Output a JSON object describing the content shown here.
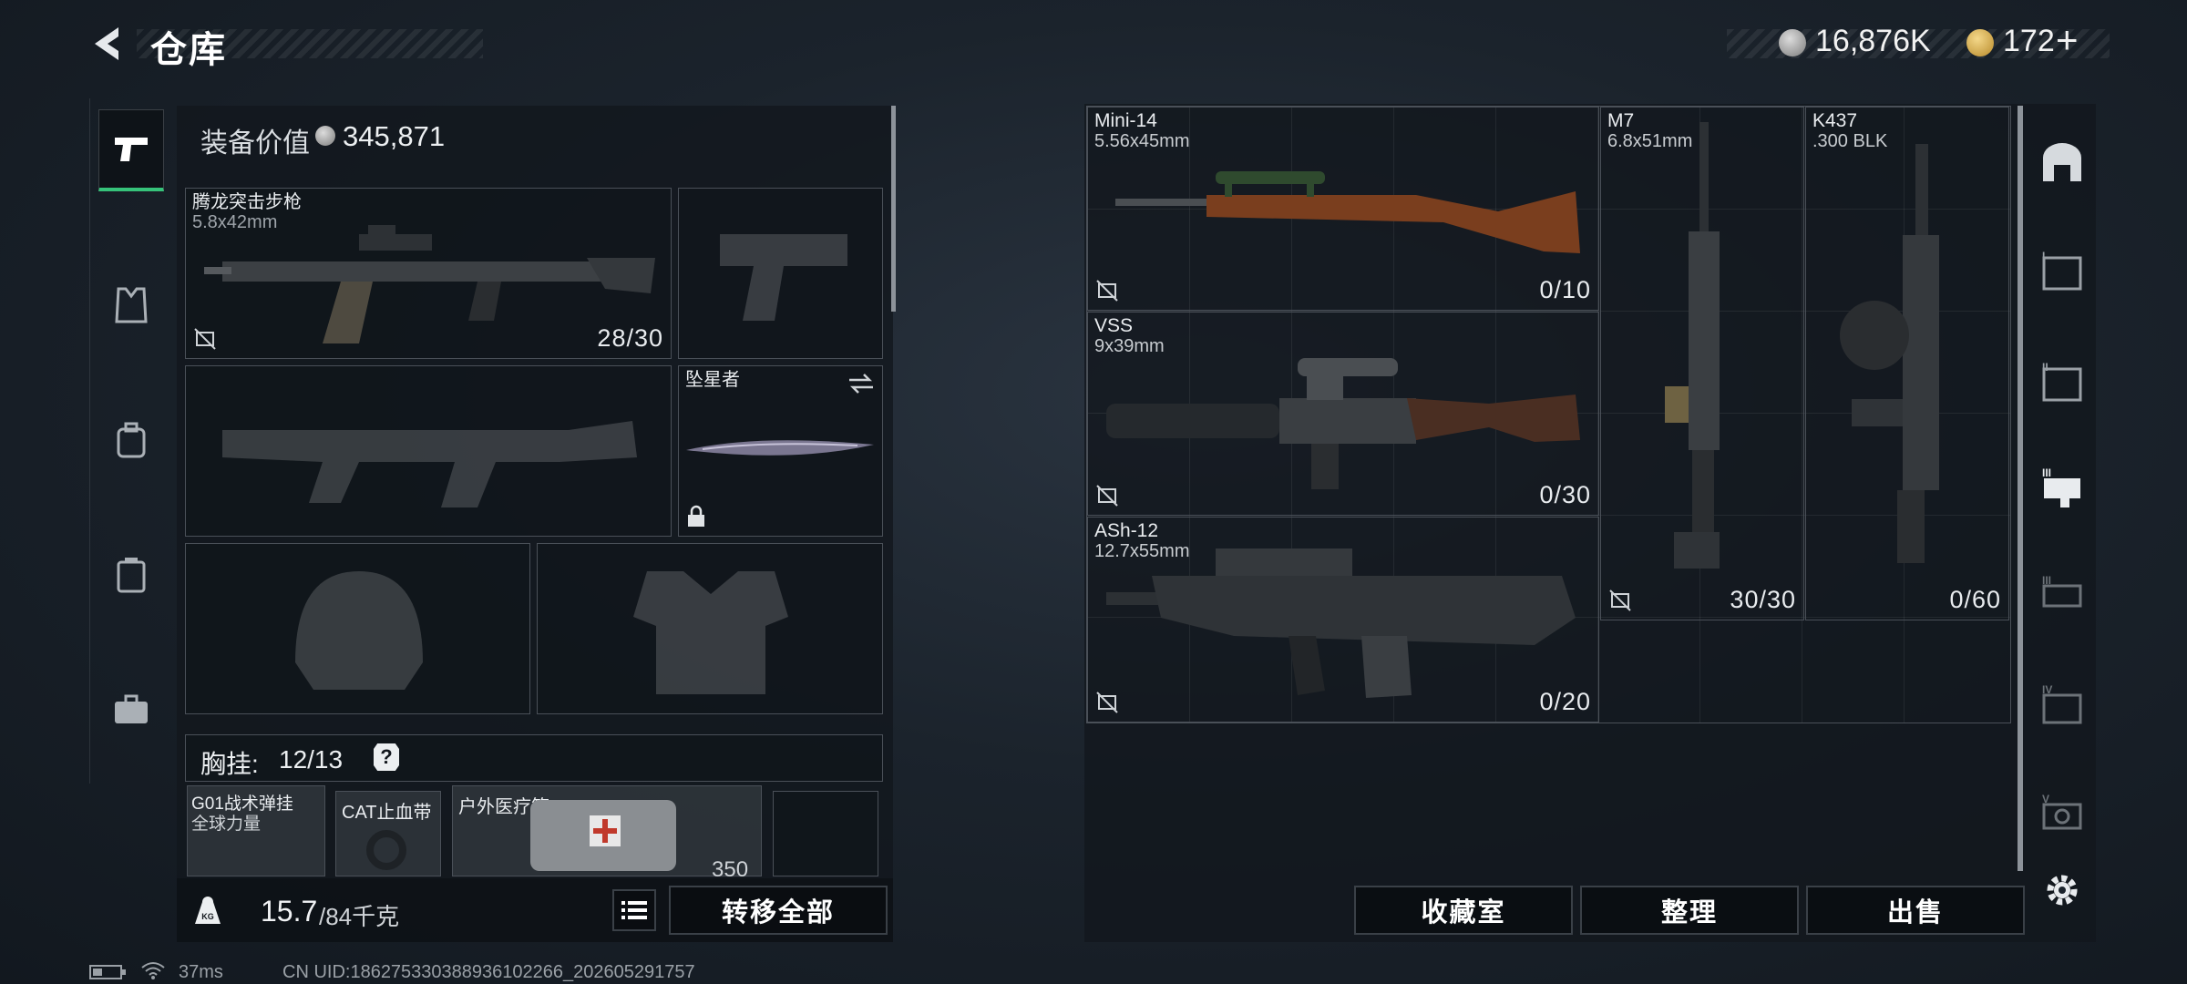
{
  "header": {
    "title": "仓库",
    "currency1_value": "16,876K",
    "currency2_value": "172",
    "currency2_plus": "+"
  },
  "equipment": {
    "value_label": "装备价值",
    "value": "345,871",
    "primary_weapon": {
      "name": "腾龙突击步枪",
      "caliber": "5.8x42mm",
      "ammo": "28/30"
    },
    "melee": {
      "name": "坠星者"
    },
    "chest_rig_label": "胸挂:",
    "chest_rig_capacity": "12/13",
    "help_symbol": "?",
    "items": [
      {
        "line1": "G01战术弹挂",
        "line2": "全球力量"
      },
      {
        "line1": "CAT止血带"
      },
      {
        "line1": "户外医疗箱",
        "value": "350"
      }
    ],
    "weight_icon_text": "KG",
    "weight_current": "15.7",
    "weight_max": "/84千克",
    "transfer_all_label": "转移全部"
  },
  "storage": {
    "weapons": [
      {
        "name": "Mini-14",
        "caliber": "5.56x45mm",
        "ammo": "0/10"
      },
      {
        "name": "VSS",
        "caliber": "9x39mm",
        "ammo": "0/30"
      },
      {
        "name": "ASh-12",
        "caliber": "12.7x55mm",
        "ammo": "0/20"
      },
      {
        "name": "M7",
        "caliber": "6.8x51mm",
        "ammo": "30/30"
      },
      {
        "name": "K437",
        "caliber": ".300 BLK",
        "ammo": "0/60"
      }
    ],
    "buttons": {
      "collection": "收藏室",
      "organize": "整理",
      "sell": "出售"
    },
    "tabs": [
      "I",
      "II",
      "III",
      "IV",
      "V"
    ]
  },
  "status_bar": {
    "ping": "37ms",
    "uid": "CN UID:18627533038893610226​6_202605291757"
  },
  "colors": {
    "accent_green": "#36c37a",
    "panel": "#12171d",
    "border": "#4a5058"
  }
}
